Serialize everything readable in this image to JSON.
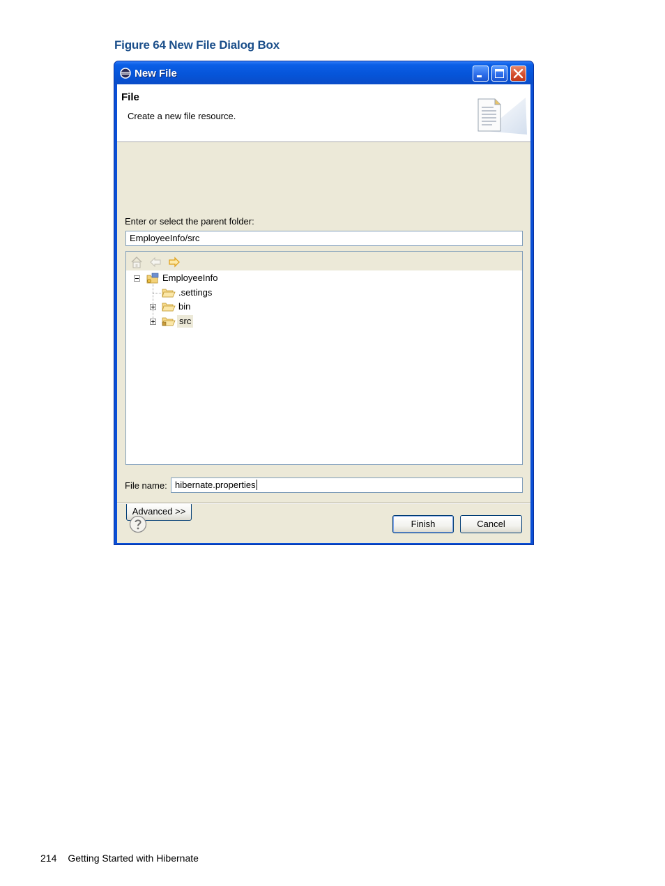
{
  "caption": "Figure 64 New File Dialog Box",
  "window": {
    "title": "New File"
  },
  "header": {
    "title": "File",
    "description": "Create a new file resource."
  },
  "parent_folder": {
    "label": "Enter or select the parent folder:",
    "value": "EmployeeInfo/src"
  },
  "tree": {
    "toolbar": [
      "home-icon",
      "back-arrow-icon",
      "forward-arrow-icon"
    ],
    "nodes": [
      {
        "label": "EmployeeInfo",
        "depth": 0,
        "expanded": true,
        "icon": "project-icon"
      },
      {
        "label": ".settings",
        "depth": 1,
        "expanded": false,
        "icon": "folder-icon"
      },
      {
        "label": "bin",
        "depth": 1,
        "expanded": false,
        "icon": "folder-icon"
      },
      {
        "label": "src",
        "depth": 1,
        "expanded": false,
        "icon": "package-folder-icon",
        "selected": true
      }
    ]
  },
  "file_name": {
    "label": "File name:",
    "value": "hibernate.properties"
  },
  "buttons": {
    "advanced": "Advanced >>",
    "finish": "Finish",
    "cancel": "Cancel"
  },
  "footer": {
    "page_number": "214",
    "text": "Getting Started with Hibernate"
  },
  "colors": {
    "titlebar": "#0a4fd6",
    "caption": "#1a4e8a",
    "dialog_bg": "#ece9d8",
    "selection": "#ece9d8"
  }
}
